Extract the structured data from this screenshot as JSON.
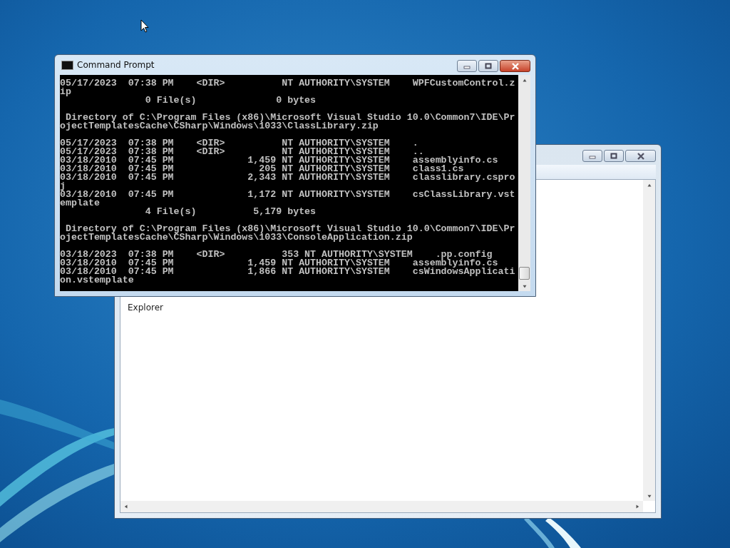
{
  "windows": [
    {
      "kind": "console",
      "active": true,
      "title": "Command Prompt",
      "blocks": [
        [
          "05/17/2023  07:38 PM    <DIR>          NT AUTHORITY\\SYSTEM    WPFCustomControl.z",
          "ip",
          "               0 File(s)              0 bytes"
        ],
        [
          " Directory of C:\\Program Files (x86)\\Microsoft Visual Studio 10.0\\Common7\\IDE\\Pr",
          "ojectTemplatesCache\\CSharp\\Windows\\1033\\ClassLibrary.zip"
        ],
        [
          "05/17/2023  07:38 PM    <DIR>          NT AUTHORITY\\SYSTEM    .",
          "05/17/2023  07:38 PM    <DIR>          NT AUTHORITY\\SYSTEM    ..",
          "03/18/2010  07:45 PM             1,459 NT AUTHORITY\\SYSTEM    assemblyinfo.cs",
          "03/18/2010  07:45 PM               205 NT AUTHORITY\\SYSTEM    class1.cs",
          "03/18/2010  07:45 PM             2,343 NT AUTHORITY\\SYSTEM    classlibrary.cspro",
          "j",
          "03/18/2010  07:45 PM             1,172 NT AUTHORITY\\SYSTEM    csClassLibrary.vst",
          "emplate",
          "               4 File(s)          5,179 bytes"
        ],
        [
          " Directory of C:\\Program Files (x86)\\Microsoft Visual Studio 10.0\\Common7\\IDE\\Pr",
          "ojectTemplatesCache\\CSharp\\Windows\\1033\\ConsoleApplication.zip"
        ],
        [
          "03/18/2023  07:38 PM    <DIR>          353 NT AUTHORITY\\SYSTEM    .pp.config",
          "03/18/2010  07:45 PM             1,459 NT AUTHORITY\\SYSTEM    assemblyinfo.cs",
          "03/18/2010  07:45 PM             1,866 NT AUTHORITY\\SYSTEM    csWindowsApplicati",
          "on.vstemplate"
        ]
      ]
    },
    {
      "kind": "explorer",
      "active": false,
      "text": "Explorer"
    }
  ]
}
